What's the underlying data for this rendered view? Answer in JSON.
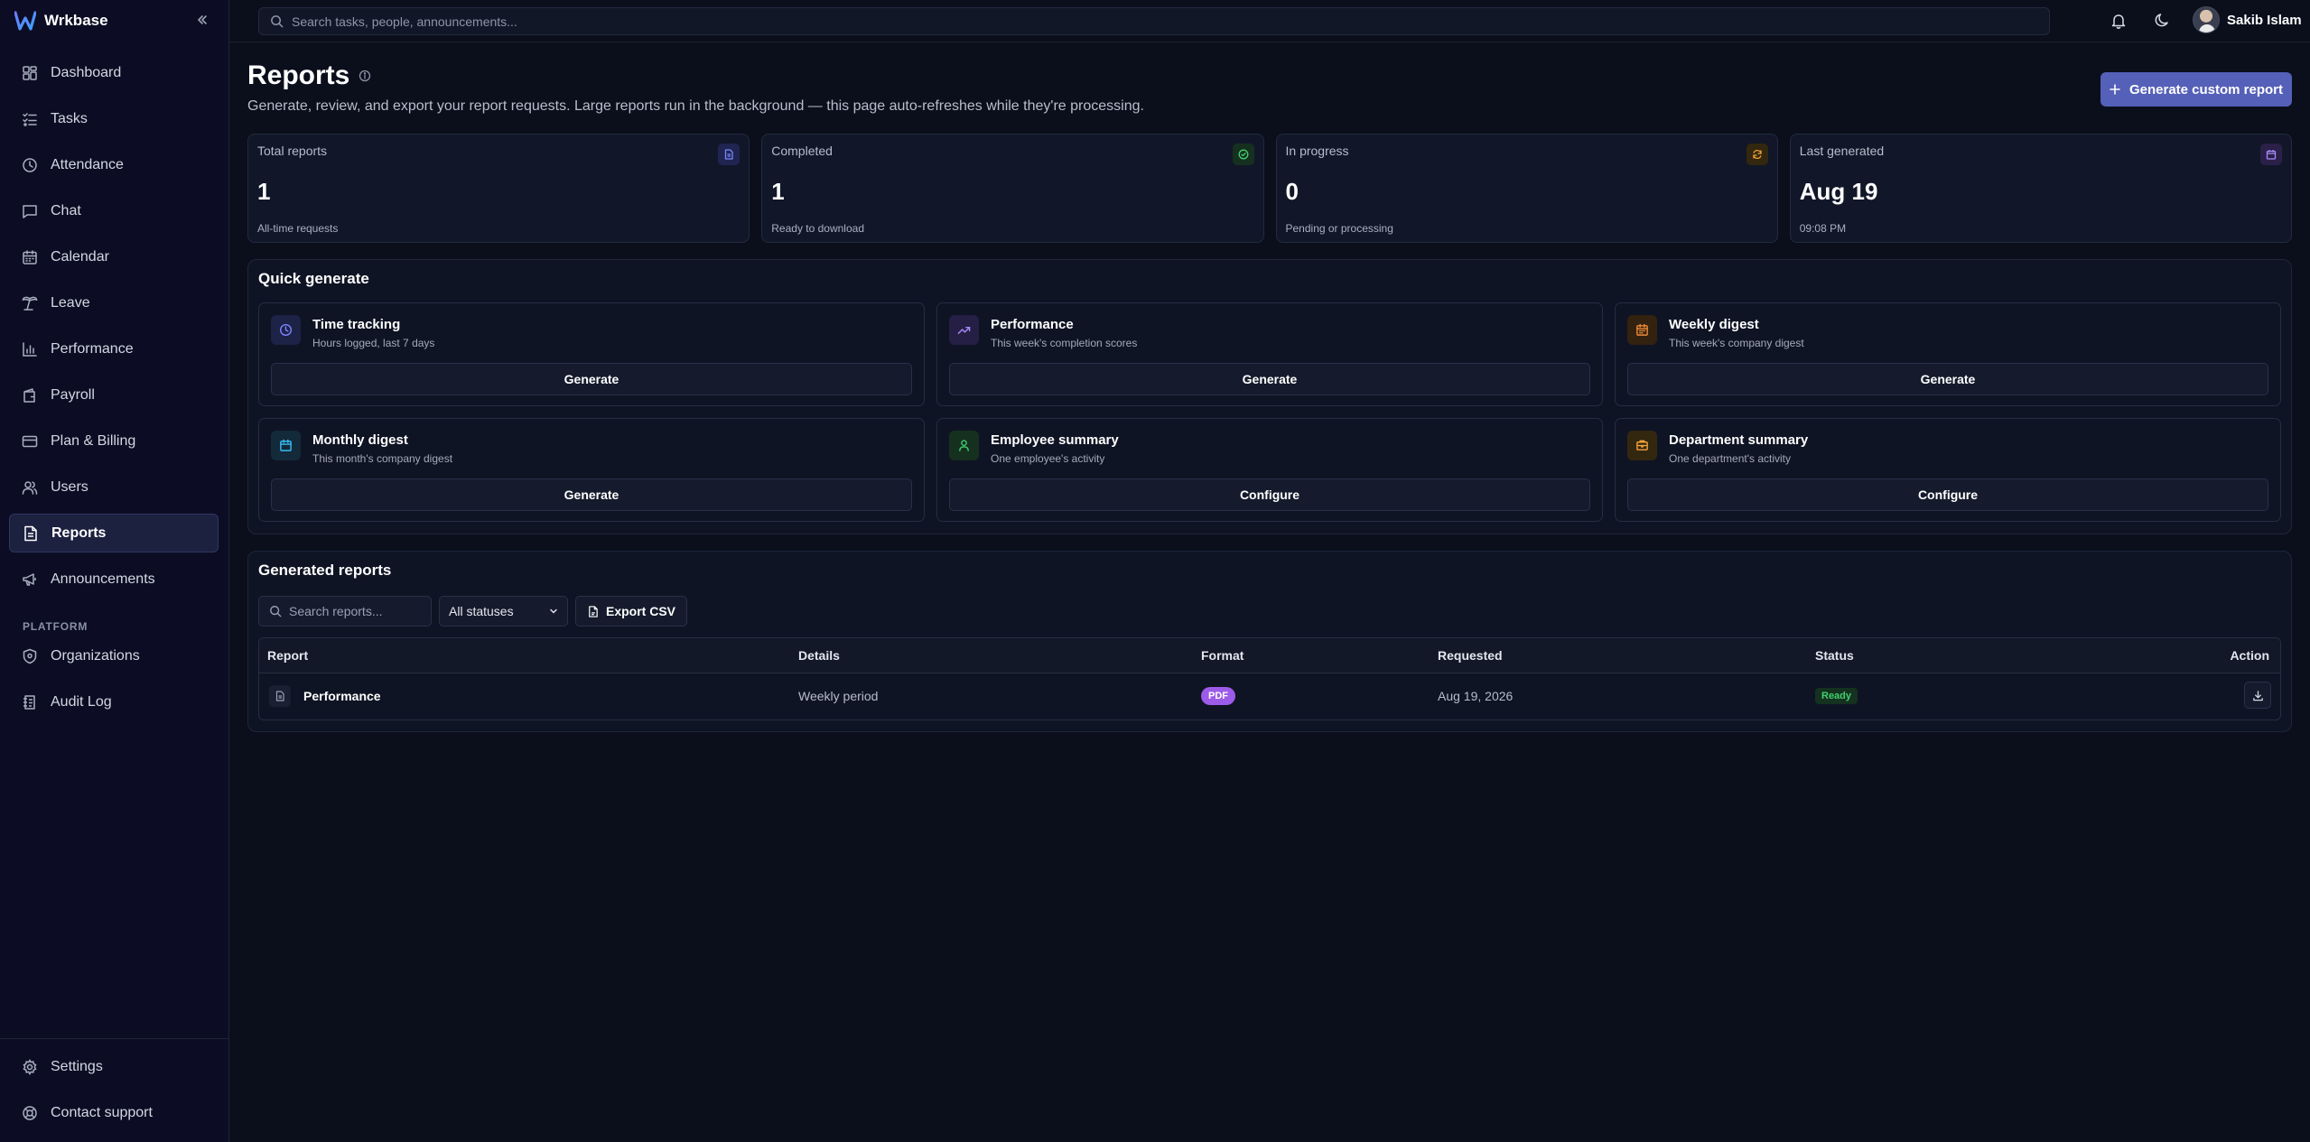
{
  "app": {
    "name": "Wrkbase"
  },
  "sidebar": {
    "items": [
      {
        "label": "Dashboard",
        "icon": "dashboard-icon"
      },
      {
        "label": "Tasks",
        "icon": "tasks-icon"
      },
      {
        "label": "Attendance",
        "icon": "clock-icon"
      },
      {
        "label": "Chat",
        "icon": "chat-icon"
      },
      {
        "label": "Calendar",
        "icon": "calendar-icon"
      },
      {
        "label": "Leave",
        "icon": "leave-icon"
      },
      {
        "label": "Performance",
        "icon": "bar-chart-icon"
      },
      {
        "label": "Payroll",
        "icon": "wallet-icon"
      },
      {
        "label": "Plan & Billing",
        "icon": "credit-card-icon"
      },
      {
        "label": "Users",
        "icon": "users-icon"
      },
      {
        "label": "Reports",
        "icon": "report-icon",
        "active": true
      },
      {
        "label": "Announcements",
        "icon": "megaphone-icon"
      }
    ],
    "platform_label": "PLATFORM",
    "platform_items": [
      {
        "label": "Organizations",
        "icon": "shield-icon"
      },
      {
        "label": "Audit Log",
        "icon": "audit-log-icon"
      }
    ],
    "bottom_items": [
      {
        "label": "Settings",
        "icon": "gear-icon"
      },
      {
        "label": "Contact support",
        "icon": "support-icon"
      }
    ]
  },
  "topbar": {
    "search_placeholder": "Search tasks, people, announcements...",
    "user_name": "Sakib Islam"
  },
  "page": {
    "title": "Reports",
    "subtitle": "Generate, review, and export your report requests. Large reports run in the background — this page auto-refreshes while they're processing.",
    "primary_button": "Generate custom report"
  },
  "stats": [
    {
      "label": "Total reports",
      "value": "1",
      "sub": "All-time requests",
      "icon": "document-icon",
      "color": "#7c86ff"
    },
    {
      "label": "Completed",
      "value": "1",
      "sub": "Ready to download",
      "icon": "check-circle-icon",
      "color": "#3fcf6f"
    },
    {
      "label": "In progress",
      "value": "0",
      "sub": "Pending or processing",
      "icon": "refresh-icon",
      "color": "#f0a13a"
    },
    {
      "label": "Last generated",
      "value": "Aug 19",
      "sub": "09:08 PM",
      "icon": "calendar-icon",
      "color": "#a78bfa"
    }
  ],
  "quick_generate": {
    "title": "Quick generate",
    "cards": [
      {
        "name": "Time tracking",
        "desc": "Hours logged, last 7 days",
        "button": "Generate",
        "icon": "clock-icon",
        "color": "#7c86ff"
      },
      {
        "name": "Performance",
        "desc": "This week's completion scores",
        "button": "Generate",
        "icon": "trend-up-icon",
        "color": "#a78bfa"
      },
      {
        "name": "Weekly digest",
        "desc": "This week's company digest",
        "button": "Generate",
        "icon": "calendar-icon",
        "color": "#f08a3a"
      },
      {
        "name": "Monthly digest",
        "desc": "This month's company digest",
        "button": "Generate",
        "icon": "calendar-icon",
        "color": "#38bdf8"
      },
      {
        "name": "Employee summary",
        "desc": "One employee's activity",
        "button": "Configure",
        "icon": "user-icon",
        "color": "#3fcf6f"
      },
      {
        "name": "Department summary",
        "desc": "One department's activity",
        "button": "Configure",
        "icon": "building-icon",
        "color": "#f0a13a"
      }
    ]
  },
  "generated_reports": {
    "title": "Generated reports",
    "search_placeholder": "Search reports...",
    "status_filter": "All statuses",
    "export_button": "Export CSV",
    "columns": [
      "Report",
      "Details",
      "Format",
      "Requested",
      "Status",
      "Action"
    ],
    "rows": [
      {
        "report": "Performance",
        "details": "Weekly period",
        "format": "PDF",
        "requested": "Aug 19, 2026",
        "status": "Ready"
      }
    ]
  }
}
